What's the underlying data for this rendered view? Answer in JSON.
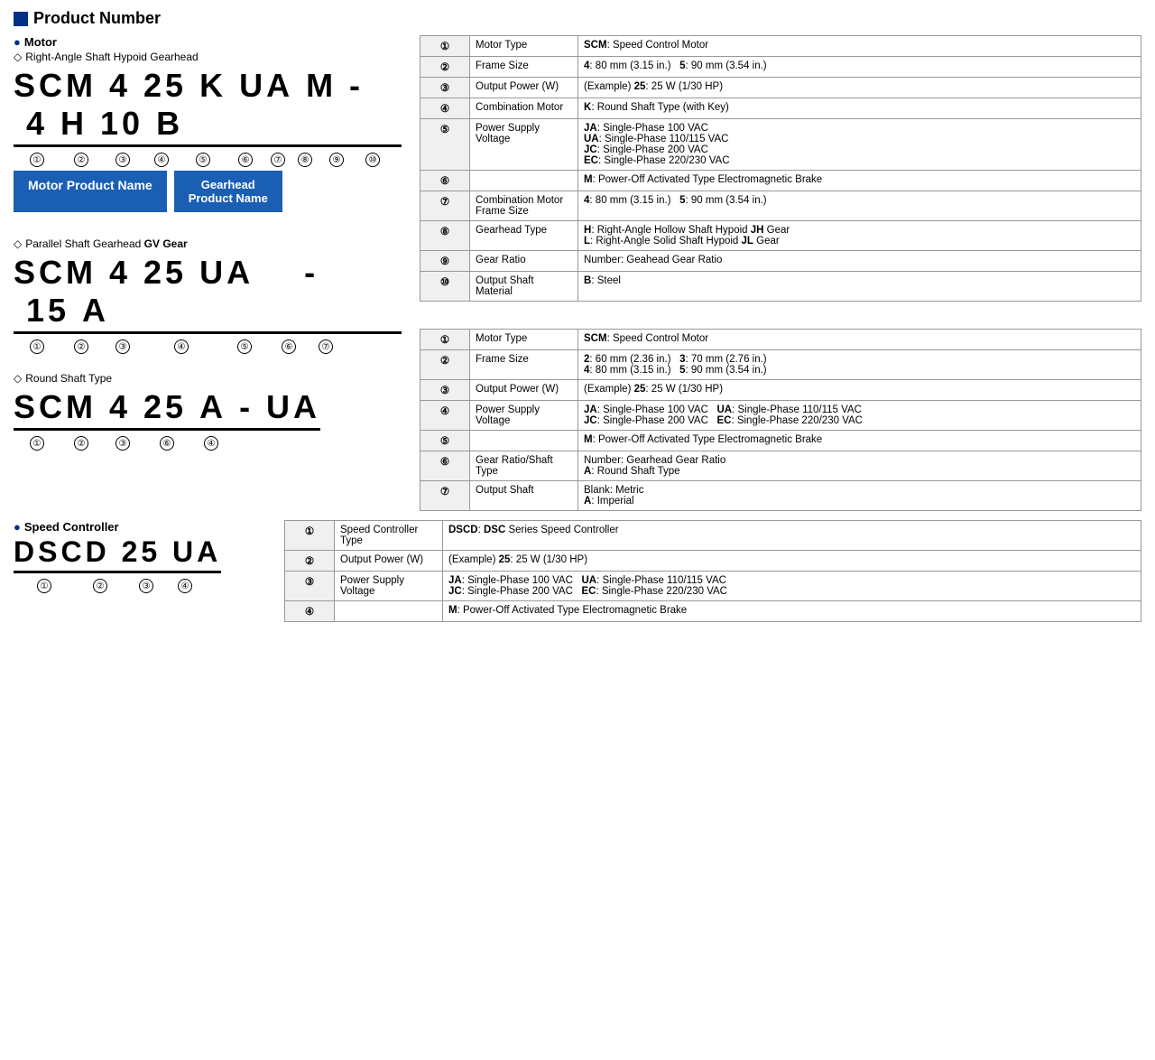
{
  "page": {
    "title": "Product Number",
    "section_motor": "Motor",
    "section_speed_controller": "Speed Controller",
    "subsections": {
      "right_angle": "Right-Angle Shaft Hypoid Gearhead",
      "parallel_shaft": "Parallel Shaft Gearhead GV Gear",
      "round_shaft": "Round Shaft Type"
    },
    "product_codes": {
      "right_angle": "SCM 4 25 K UA M - 4 H 10 B",
      "parallel": "SCM 4 25 UA   - 15 A",
      "round": "SCM 4 25 A - UA",
      "speed": "DSCD 25 UA"
    },
    "name_boxes": {
      "motor": "Motor Product Name",
      "gearhead": "Gearhead\nProduct Name"
    },
    "table1": {
      "rows": [
        {
          "num": "①",
          "label": "Motor Type",
          "value": "<b>SCM</b>: Speed Control Motor",
          "rowspan_label": "Motor\nProduct\nName",
          "rowspan_rows": [
            "①",
            "②",
            "③",
            "④",
            "⑤",
            "⑥"
          ]
        },
        {
          "num": "②",
          "label": "Frame Size",
          "value": "<b>4</b>: 80 mm (3.15 in.)    <b>5</b>: 90 mm (3.54 in.)"
        },
        {
          "num": "③",
          "label": "Output Power (W)",
          "value": "(Example) <b>25</b>: 25 W (1/30 HP)"
        },
        {
          "num": "④",
          "label": "Combination Motor",
          "value": "<b>K</b>: Round Shaft Type (with Key)"
        },
        {
          "num": "⑤",
          "label": "Power Supply Voltage",
          "value": "<b>JA</b>: Single-Phase 100 VAC\n<b>UA</b>: Single-Phase 110/115 VAC\n<b>JC</b>: Single-Phase 200 VAC\n<b>EC</b>: Single-Phase 220/230 VAC"
        },
        {
          "num": "⑥",
          "label": "",
          "value": "<b>M</b>: Power-Off Activated Type Electromagnetic Brake"
        },
        {
          "num": "⑦",
          "label": "Combination Motor\nFrame Size",
          "value": "<b>4</b>: 80 mm (3.15 in.)    <b>5</b>: 90 mm (3.54 in.)",
          "rowspan_label": "Gearhead\nProduct\nName",
          "rowspan_rows": [
            "⑦",
            "⑧",
            "⑨",
            "⑩"
          ]
        },
        {
          "num": "⑧",
          "label": "Gearhead Type",
          "value": "<b>H</b>: Right-Angle Hollow Shaft Hypoid <b>JH</b> Gear\n<b>L</b>: Right-Angle Solid Shaft Hypoid <b>JL</b> Gear"
        },
        {
          "num": "⑨",
          "label": "Gear Ratio",
          "value": "Number: Geahead Gear Ratio"
        },
        {
          "num": "⑩",
          "label": "Output Shaft Material",
          "value": "<b>B</b>: Steel"
        }
      ]
    },
    "table2": {
      "rows": [
        {
          "num": "①",
          "label": "Motor Type",
          "value": "<b>SCM</b>: Speed Control Motor"
        },
        {
          "num": "②",
          "label": "Frame Size",
          "value": "<b>2</b>: 60 mm (2.36 in.)    <b>3</b>: 70 mm (2.76 in.)\n<b>4</b>: 80 mm (3.15 in.)    <b>5</b>: 90 mm (3.54 in.)"
        },
        {
          "num": "③",
          "label": "Output Power (W)",
          "value": "(Example) <b>25</b>: 25 W (1/30 HP)"
        },
        {
          "num": "④",
          "label": "Power Supply Voltage",
          "value": "<b>JA</b>: Single-Phase 100 VAC    <b>UA</b>: Single-Phase 110/115 VAC\n<b>JC</b>: Single-Phase 200 VAC    <b>EC</b>: Single-Phase 220/230 VAC"
        },
        {
          "num": "⑤",
          "label": "",
          "value": "<b>M</b>: Power-Off Activated Type Electromagnetic Brake"
        },
        {
          "num": "⑥",
          "label": "Gear Ratio/Shaft\nType",
          "value": "Number: Gearhead Gear Ratio\n<b>A</b>: Round Shaft Type"
        },
        {
          "num": "⑦",
          "label": "Output Shaft",
          "value": "Blank: Metric\n<b>A</b>: Imperial"
        }
      ]
    },
    "table3": {
      "rows": [
        {
          "num": "①",
          "label": "Speed Controller\nType",
          "value": "<b>DSCD</b>: <b>DSC</b> Series Speed Controller"
        },
        {
          "num": "②",
          "label": "Output Power (W)",
          "value": "(Example) <b>25</b>: 25 W (1/30 HP)"
        },
        {
          "num": "③",
          "label": "Power Supply Voltage",
          "value": "<b>JA</b>: Single-Phase 100 VAC    <b>UA</b>: Single-Phase 110/115 VAC\n<b>JC</b>: Single-Phase 200 VAC    <b>EC</b>: Single-Phase 220/230 VAC"
        },
        {
          "num": "④",
          "label": "",
          "value": "<b>M</b>: Power-Off Activated Type Electromagnetic Brake"
        }
      ]
    }
  }
}
